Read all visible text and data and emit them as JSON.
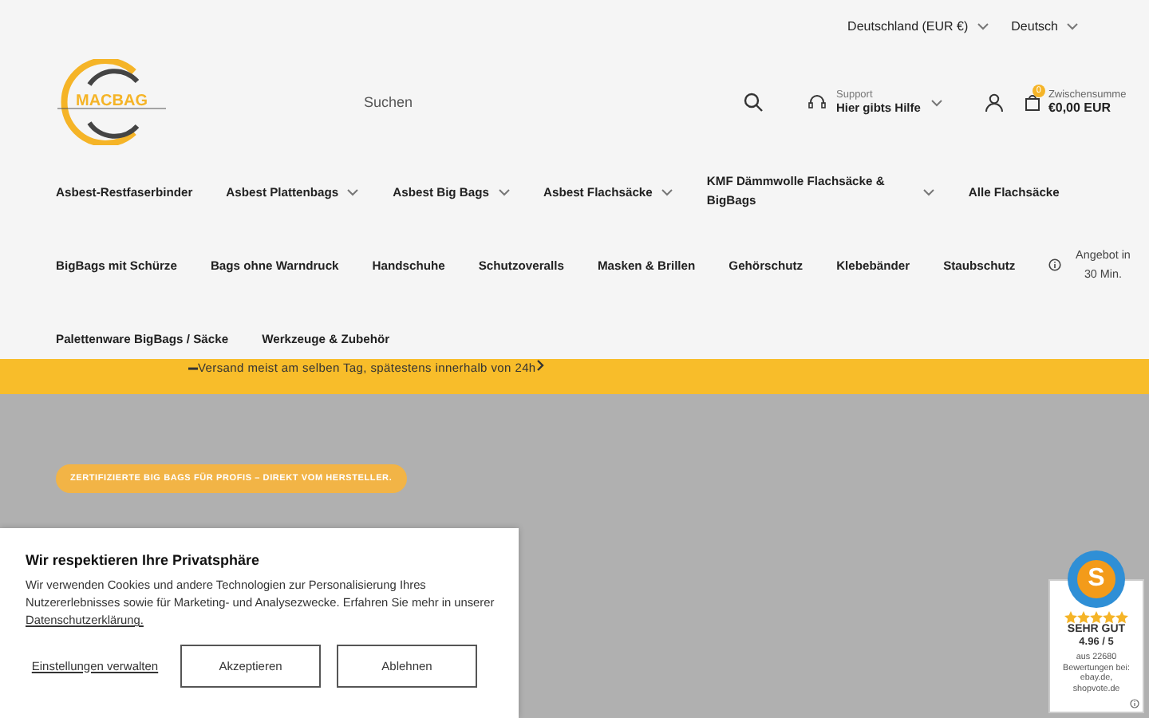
{
  "topbar": {
    "country": "Deutschland (EUR €)",
    "language": "Deutsch"
  },
  "header": {
    "logo": "MACBAG",
    "search": {
      "placeholder": "Suchen"
    },
    "support": {
      "label": "Support",
      "value": "Hier gibts Hilfe"
    },
    "cart": {
      "count": "0",
      "label": "Zwischensumme",
      "total": "€0,00 EUR"
    }
  },
  "nav": {
    "items": [
      {
        "label": "Asbest-Restfaserbinder",
        "has_dropdown": false
      },
      {
        "label": "Asbest Plattenbags",
        "has_dropdown": true
      },
      {
        "label": "Asbest Big Bags",
        "has_dropdown": true
      },
      {
        "label": "Asbest Flachsäcke",
        "has_dropdown": true
      },
      {
        "label": "KMF Dämmwolle Flachsäcke & BigBags",
        "has_dropdown": true,
        "kind": "wrap"
      },
      {
        "label": "Alle Flachsäcke",
        "has_dropdown": false
      },
      {
        "label": "BigBags mit Schürze",
        "has_dropdown": false
      },
      {
        "label": "Bags ohne Warndruck",
        "has_dropdown": false
      },
      {
        "label": "Handschuhe",
        "has_dropdown": false
      },
      {
        "label": "Schutzoveralls",
        "has_dropdown": false
      },
      {
        "label": "Masken & Brillen",
        "has_dropdown": false
      },
      {
        "label": "Gehörschutz",
        "has_dropdown": false
      },
      {
        "label": "Klebebänder",
        "has_dropdown": false
      },
      {
        "label": "Staubschutz",
        "has_dropdown": false
      },
      {
        "label": "Angebot in 30 Min.",
        "has_dropdown": false,
        "kind": "info"
      },
      {
        "label": "Palettenware BigBags / Säcke",
        "has_dropdown": false
      },
      {
        "label": "Werkzeuge & Zubehör",
        "has_dropdown": false
      }
    ]
  },
  "announcement": {
    "text": "Versand meist am selben Tag, spätestens innerhalb von 24h"
  },
  "hero": {
    "tagline": "ZERTIFIZIERTE BIG BAGS FÜR PROFIS – DIREKT VOM HERSTELLER."
  },
  "cookie_banner": {
    "title": "Wir respektieren Ihre Privatsphäre",
    "text": "Wir verwenden Cookies und andere Technologien zur Personalisierung Ihres Nutzererlebnisses sowie für Marketing- und Analysezwecke. Erfahren Sie mehr in unserer ",
    "link": "Datenschutzerklärung.",
    "settings": "Einstellungen verwalten",
    "buttons": [
      "Akzeptieren",
      "Ablehnen"
    ]
  },
  "trust_badge": {
    "logo": "S",
    "rating_label": "SEHR GUT",
    "score": "4.96 / 5",
    "stars": 5,
    "reviews": "aus 22680 Bewertungen bei: ebay.de, shopvote.de"
  }
}
